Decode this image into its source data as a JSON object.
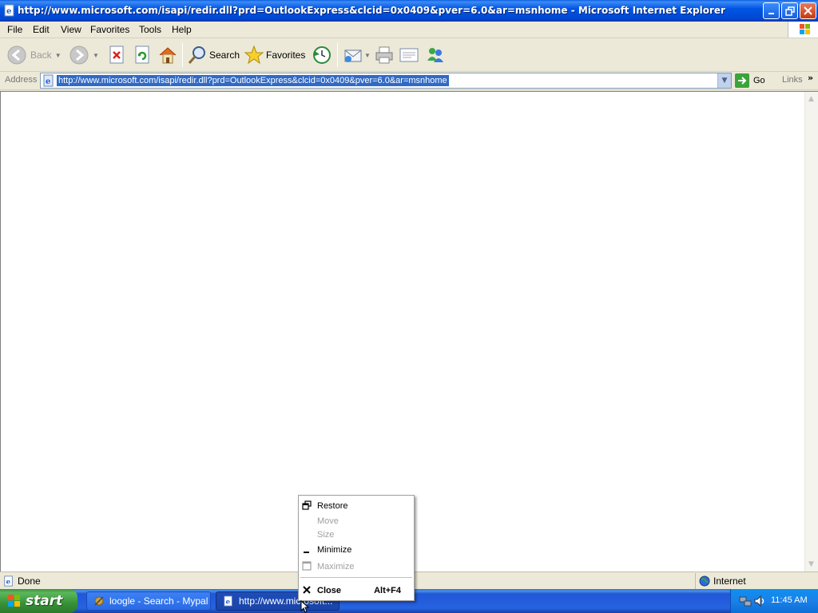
{
  "window": {
    "title": "http://www.microsoft.com/isapi/redir.dll?prd=OutlookExpress&clcid=0x0409&pver=6.0&ar=msnhome - Microsoft Internet Explorer"
  },
  "menubar": {
    "items": [
      "File",
      "Edit",
      "View",
      "Favorites",
      "Tools",
      "Help"
    ]
  },
  "toolbar": {
    "back_label": "Back",
    "search_label": "Search",
    "favorites_label": "Favorites"
  },
  "address": {
    "label": "Address",
    "url": "http://www.microsoft.com/isapi/redir.dll?prd=OutlookExpress&clcid=0x0409&pver=6.0&ar=msnhome",
    "go_label": "Go",
    "links_label": "Links"
  },
  "status": {
    "text": "Done",
    "zone": "Internet"
  },
  "taskbar": {
    "start_label": "start",
    "tasks": [
      {
        "label": "loogle - Search - Mypal"
      },
      {
        "label": "http://www.microsoft..."
      }
    ],
    "clock": "11:45 AM"
  },
  "context_menu": {
    "items": [
      {
        "label": "Restore",
        "enabled": true
      },
      {
        "label": "Move",
        "enabled": false
      },
      {
        "label": "Size",
        "enabled": false
      },
      {
        "label": "Minimize",
        "enabled": true
      },
      {
        "label": "Maximize",
        "enabled": false
      },
      {
        "label": "Close",
        "enabled": true,
        "accel": "Alt+F4"
      }
    ]
  },
  "colors": {
    "titlebar": "#0055e5",
    "selection": "#316ac5",
    "taskbar": "#2663e0",
    "start": "#379237"
  }
}
